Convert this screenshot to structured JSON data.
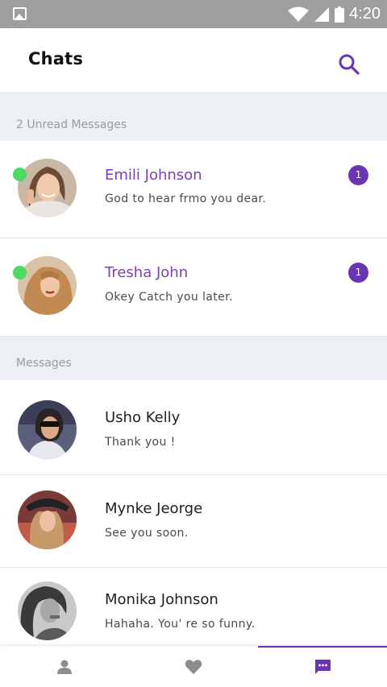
{
  "status_bar": {
    "time": "4:20"
  },
  "header": {
    "title": "Chats"
  },
  "sections": {
    "unread_label": "2 Unread Messages",
    "messages_label": "Messages"
  },
  "unread": [
    {
      "name": "Emili Johnson",
      "message": "God to hear frmo you dear.",
      "badge": "1"
    },
    {
      "name": "Tresha John",
      "message": "Okey Catch you later.",
      "badge": "1"
    }
  ],
  "messages": [
    {
      "name": "Usho Kelly",
      "message": "Thank you !"
    },
    {
      "name": "Mynke Jeorge",
      "message": "See you soon."
    },
    {
      "name": "Monika Johnson",
      "message": "Hahaha. You' re so funny."
    }
  ],
  "colors": {
    "accent": "#6a35b2",
    "online": "#4cd964",
    "section_bg": "#eceff3",
    "status_bar": "#9e9e9e"
  },
  "icons": {
    "status": [
      "image-icon",
      "wifi-icon",
      "signal-icon",
      "battery-icon"
    ],
    "header": "search-icon",
    "nav": [
      "person-icon",
      "heart-icon",
      "chat-icon"
    ]
  }
}
